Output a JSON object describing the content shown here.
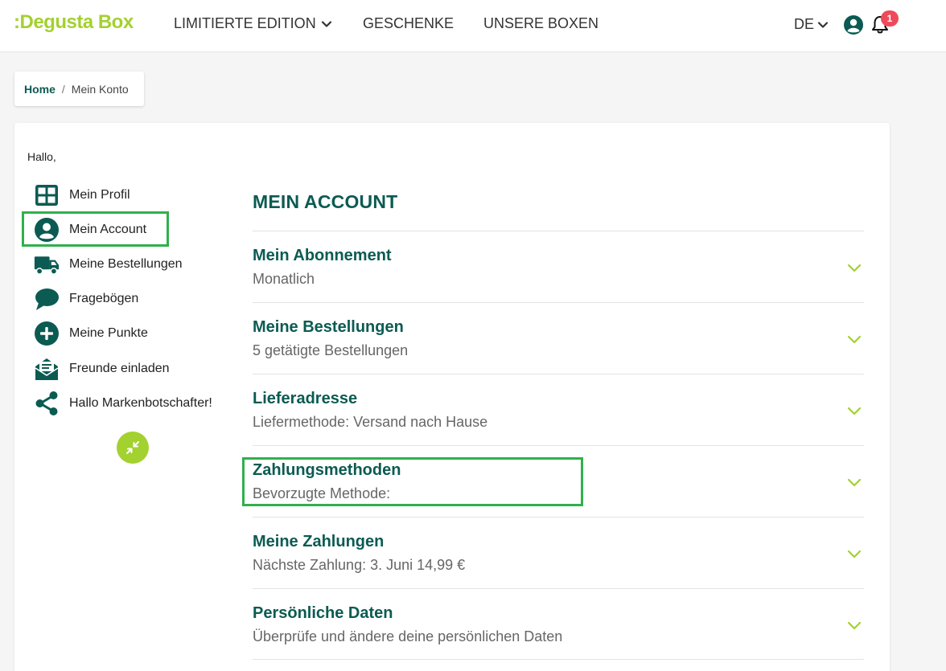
{
  "header": {
    "logo": ":Degusta Box",
    "nav": [
      "LIMITIERTE EDITION",
      "GESCHENKE",
      "UNSERE BOXEN"
    ],
    "lang": "DE",
    "notification_count": "1"
  },
  "breadcrumb": {
    "home": "Home",
    "sep": "/",
    "current": "Mein Konto"
  },
  "greeting": "Hallo,",
  "sidebar": {
    "items": [
      {
        "label": "Mein Profil",
        "icon": "grid-icon"
      },
      {
        "label": "Mein Account",
        "icon": "user-circle-icon"
      },
      {
        "label": "Meine Bestellungen",
        "icon": "truck-icon"
      },
      {
        "label": "Fragebögen",
        "icon": "chat-bubble-icon"
      },
      {
        "label": "Meine Punkte",
        "icon": "plus-circle-icon"
      },
      {
        "label": "Freunde einladen",
        "icon": "envelope-icon"
      },
      {
        "label": "Hallo Markenbotschafter!",
        "icon": "share-icon"
      }
    ]
  },
  "main": {
    "title": "MEIN ACCOUNT",
    "rows": [
      {
        "title": "Mein Abonnement",
        "subtitle": "Monatlich"
      },
      {
        "title": "Meine Bestellungen",
        "subtitle": "5 getätigte Bestellungen"
      },
      {
        "title": "Lieferadresse",
        "subtitle": "Liefermethode: Versand nach Hause"
      },
      {
        "title": "Zahlungsmethoden",
        "subtitle": "Bevorzugte Methode:"
      },
      {
        "title": "Meine Zahlungen",
        "subtitle": "Nächste Zahlung: 3. Juni 14,99 €"
      },
      {
        "title": "Persönliche Daten",
        "subtitle": "Überprüfe und ändere deine persönlichen Daten"
      }
    ]
  },
  "colors": {
    "brand_green": "#a3d12f",
    "dark_teal": "#0b5b52",
    "highlight": "#2fb14b",
    "badge_red": "#ef4a5a"
  }
}
